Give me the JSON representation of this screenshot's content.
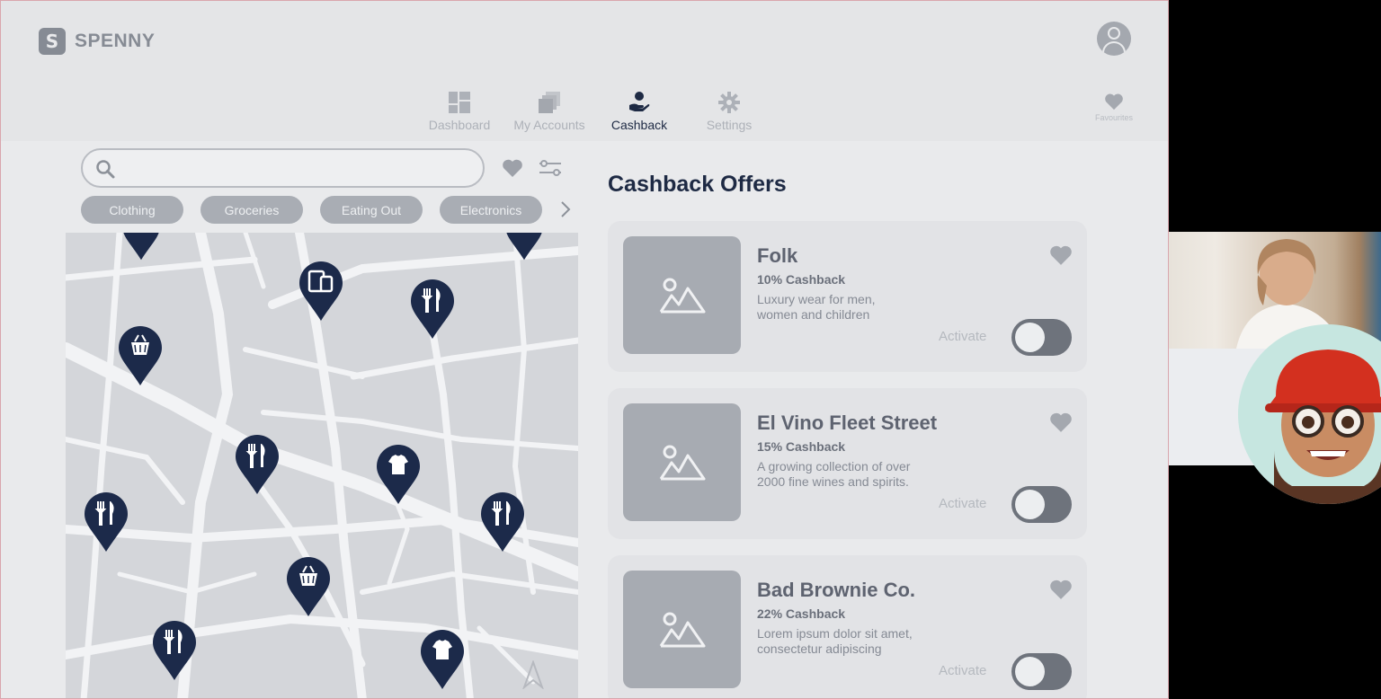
{
  "app": {
    "name": "SPENNY",
    "logo_letter": "S"
  },
  "nav": {
    "items": [
      {
        "label": "Dashboard",
        "icon": "dashboard-icon",
        "active": false
      },
      {
        "label": "My Accounts",
        "icon": "accounts-icon",
        "active": false
      },
      {
        "label": "Cashback",
        "icon": "cashback-icon",
        "active": true
      },
      {
        "label": "Settings",
        "icon": "gear-icon",
        "active": false
      }
    ],
    "favourites_label": "Favourites"
  },
  "search": {
    "value": "",
    "placeholder": ""
  },
  "categories": [
    "Clothing",
    "Groceries",
    "Eating Out",
    "Electronics"
  ],
  "section_title": "Cashback Offers",
  "offers": [
    {
      "name": "Folk",
      "cashback": "10% Cashback",
      "description": "Luxury wear for men, women and children",
      "activate_label": "Activate",
      "active": false
    },
    {
      "name": "El Vino Fleet Street",
      "cashback": "15% Cashback",
      "description": "A growing collection of over 2000 fine wines and spirits.",
      "activate_label": "Activate",
      "active": false
    },
    {
      "name": "Bad Brownie Co.",
      "cashback": "22% Cashback",
      "description": "Lorem ipsum dolor sit amet, consectetur adipiscing",
      "activate_label": "Activate",
      "active": false
    }
  ],
  "map_pins": [
    {
      "type": "restaurant"
    },
    {
      "type": "restaurant"
    },
    {
      "type": "electronics"
    },
    {
      "type": "restaurant"
    },
    {
      "type": "groceries"
    },
    {
      "type": "restaurant"
    },
    {
      "type": "clothing"
    },
    {
      "type": "restaurant"
    },
    {
      "type": "restaurant"
    },
    {
      "type": "groceries"
    },
    {
      "type": "restaurant"
    },
    {
      "type": "clothing"
    }
  ],
  "colors": {
    "navy": "#1e2a44",
    "chip": "#a9adb4",
    "toggle_off": "#6e737c",
    "pin": "#1c2a4a"
  }
}
